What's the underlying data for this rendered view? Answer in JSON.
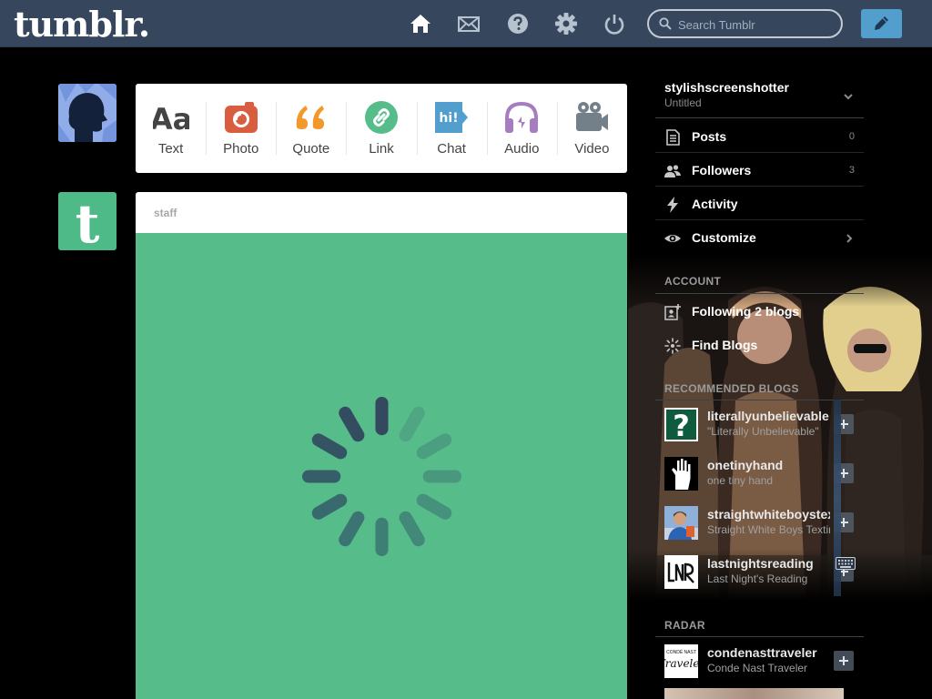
{
  "header": {
    "logo": "tumblr.",
    "nav_icons": [
      "home-icon",
      "mail-icon",
      "help-icon",
      "gear-icon",
      "power-icon"
    ],
    "search_placeholder": "Search Tumblr",
    "compose_icon": "pencil-icon",
    "bg_color": "#36465d",
    "accent_color": "#529ecc"
  },
  "post_types": [
    {
      "label": "Text",
      "icon": "text-icon",
      "color": "#444444"
    },
    {
      "label": "Photo",
      "icon": "camera-icon",
      "color": "#d95e40"
    },
    {
      "label": "Quote",
      "icon": "quote-icon",
      "color": "#f2992e"
    },
    {
      "label": "Link",
      "icon": "link-icon",
      "color": "#56bc8a"
    },
    {
      "label": "Chat",
      "icon": "chat-icon",
      "color": "#529ecc"
    },
    {
      "label": "Audio",
      "icon": "headphones-icon",
      "color": "#a77dc2"
    },
    {
      "label": "Video",
      "icon": "video-camera-icon",
      "color": "#748089"
    }
  ],
  "post": {
    "author": "staff",
    "body_color": "#56bc8a"
  },
  "sidebar": {
    "blog_name": "stylishscreenshotter",
    "blog_subtitle": "Untitled",
    "menu": [
      {
        "label": "Posts",
        "count": "0",
        "icon": "posts-icon"
      },
      {
        "label": "Followers",
        "count": "3",
        "icon": "followers-icon"
      },
      {
        "label": "Activity",
        "count": "",
        "icon": "lightning-icon"
      },
      {
        "label": "Customize",
        "count": "",
        "icon": "eye-icon"
      }
    ],
    "account_title": "ACCOUNT",
    "account": [
      {
        "label": "Following 2 blogs",
        "icon": "following-icon"
      },
      {
        "label": "Find Blogs",
        "icon": "compass-icon"
      }
    ],
    "recommended_title": "RECOMMENDED BLOGS",
    "recommended": [
      {
        "name": "literallyunbelievable",
        "desc": "\"Literally Unbelievable\"",
        "avatar": "question-mark-avatar"
      },
      {
        "name": "onetinyhand",
        "desc": "one tiny hand",
        "avatar": "hand-avatar"
      },
      {
        "name": "straightwhiteboystexting",
        "desc": "Straight White Boys Texting",
        "avatar": "person-avatar"
      },
      {
        "name": "lastnightsreading",
        "desc": "Last Night's Reading",
        "avatar": "lnr-avatar"
      }
    ],
    "radar_title": "RADAR",
    "radar": [
      {
        "name": "condenasttraveler",
        "desc": "Conde Nast Traveler",
        "avatar": "traveler-avatar"
      }
    ]
  }
}
